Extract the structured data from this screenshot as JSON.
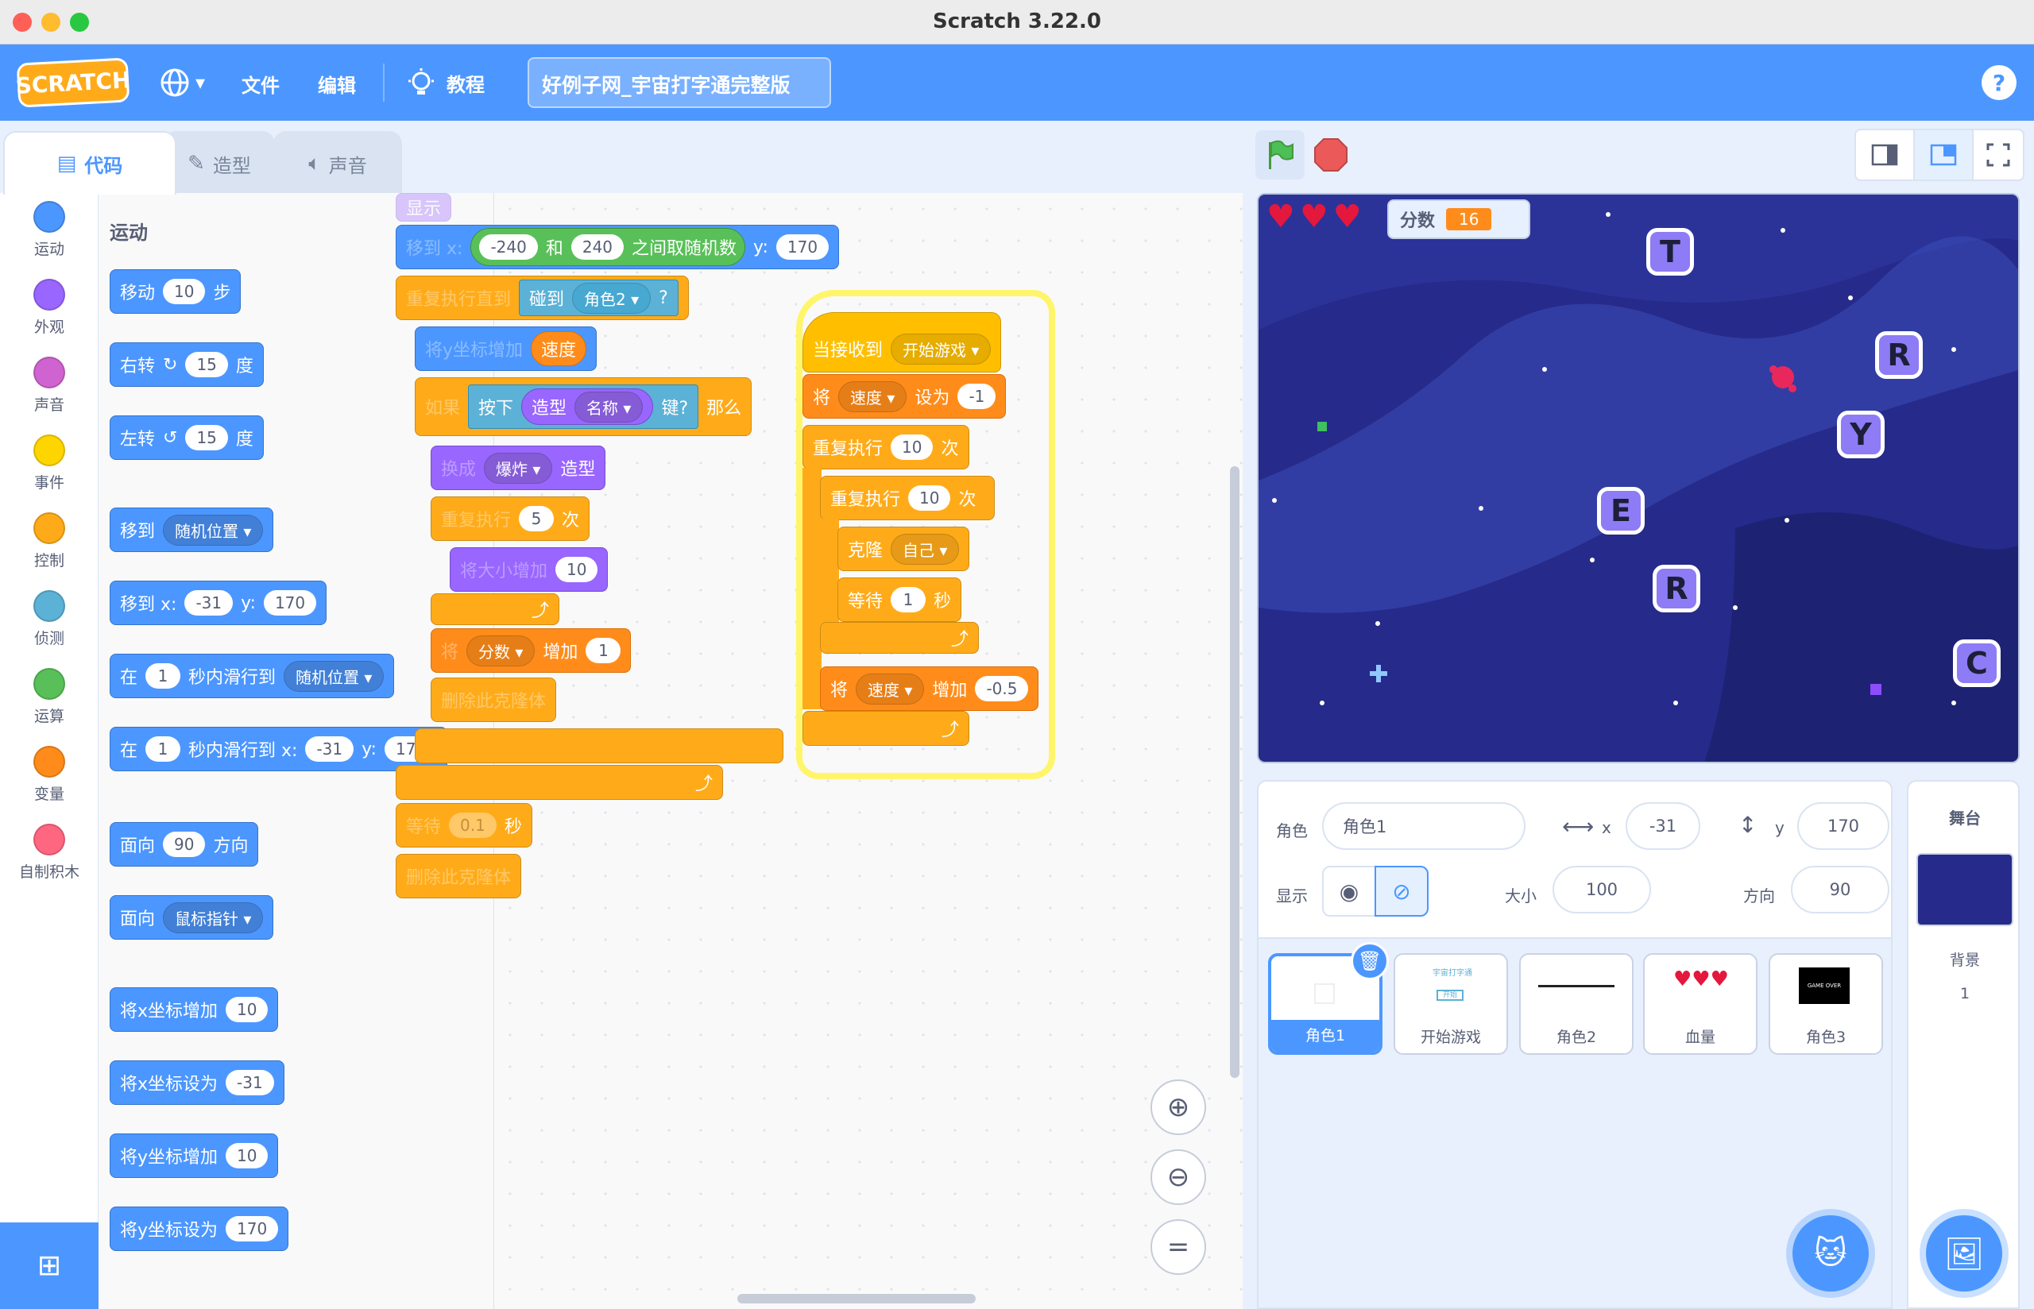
{
  "window": {
    "title": "Scratch 3.22.0"
  },
  "menu": {
    "logo": "SCRATCH",
    "file": "文件",
    "edit": "编辑",
    "tutorials": "教程",
    "project_title": "好例子网_宇宙打字通完整版",
    "help": "?"
  },
  "tabs": {
    "code": "代码",
    "costumes": "造型",
    "sounds": "声音"
  },
  "categories": [
    {
      "label": "运动",
      "color": "#4c97ff"
    },
    {
      "label": "外观",
      "color": "#9966ff"
    },
    {
      "label": "声音",
      "color": "#cf63cf"
    },
    {
      "label": "事件",
      "color": "#ffd500"
    },
    {
      "label": "控制",
      "color": "#ffab19"
    },
    {
      "label": "侦测",
      "color": "#5cb1d6"
    },
    {
      "label": "运算",
      "color": "#59c059"
    },
    {
      "label": "变量",
      "color": "#ff8c1a"
    },
    {
      "label": "自制积木",
      "color": "#ff6680"
    }
  ],
  "palette": {
    "heading": "运动",
    "move": {
      "a": "移动",
      "v": "10",
      "b": "步"
    },
    "turn_right": {
      "a": "右转",
      "v": "15",
      "b": "度"
    },
    "turn_left": {
      "a": "左转",
      "v": "15",
      "b": "度"
    },
    "goto": {
      "a": "移到",
      "v": "随机位置"
    },
    "goto_xy": {
      "a": "移到 x:",
      "x": "-31",
      "ylab": "y:",
      "y": "170"
    },
    "glide": {
      "a": "在",
      "v": "1",
      "b": "秒内滑行到",
      "c": "随机位置"
    },
    "glide_xy": {
      "a": "在",
      "v": "1",
      "b": "秒内滑行到 x:",
      "x": "-31",
      "ylab": "y:",
      "y": "170"
    },
    "point_dir": {
      "a": "面向",
      "v": "90",
      "b": "方向"
    },
    "point_towards": {
      "a": "面向",
      "v": "鼠标指针"
    },
    "change_x": {
      "a": "将x坐标增加",
      "v": "10"
    },
    "set_x": {
      "a": "将x坐标设为",
      "v": "-31"
    },
    "change_y": {
      "a": "将y坐标增加",
      "v": "10"
    },
    "set_y": {
      "a": "将y坐标设为",
      "v": "170"
    }
  },
  "script1": {
    "show": "显示",
    "goto_x": "移到 x:",
    "rand_from": "-240",
    "and": "和",
    "rand_to": "240",
    "rand_tail": "之间取随机数",
    "ylab": "y:",
    "y": "170",
    "repeat_until": "重复执行直到",
    "touching": "碰到",
    "touching_target": "角色2",
    "q": "?",
    "change_y": "将y坐标增加",
    "speed": "速度",
    "if": "如果",
    "key_press": "按下",
    "costume": "造型",
    "name": "名称",
    "key_q": "键?",
    "then": "那么",
    "switch": "换成",
    "explode": "爆炸",
    "costume2": "造型",
    "repeat": "重复执行",
    "repeat_n": "5",
    "times": "次",
    "size_change": "将大小增加",
    "size_v": "10",
    "set_var": "将",
    "score": "分数",
    "inc": "增加",
    "inc_v": "1",
    "delete_clone": "删除此克隆体",
    "wait": "等待",
    "wait_v": "0.1",
    "sec": "秒",
    "delete_clone2": "删除此克隆体"
  },
  "script2": {
    "hat": "当接收到",
    "hat_msg": "开始游戏",
    "set": "将",
    "speed": "速度",
    "set_to": "设为",
    "set_v": "-1",
    "repeat": "重复执行",
    "repeat_n": "10",
    "times": "次",
    "repeat2": "重复执行",
    "repeat2_n": "10",
    "times2": "次",
    "clone": "克隆",
    "clone_target": "自己",
    "wait": "等待",
    "wait_v": "1",
    "sec": "秒",
    "change": "将",
    "speed2": "速度",
    "inc": "增加",
    "inc_v": "-0.5"
  },
  "stage": {
    "score_label": "分数",
    "score_value": "16",
    "hearts": 3,
    "letters": [
      "T",
      "R",
      "Y",
      "E",
      "R",
      "C"
    ]
  },
  "sprite_info": {
    "sprite_label": "角色",
    "sprite_name": "角色1",
    "x_label": "x",
    "x": "-31",
    "y_label": "y",
    "y": "170",
    "show_label": "显示",
    "size_label": "大小",
    "size": "100",
    "direction_label": "方向",
    "direction": "90"
  },
  "sprites": [
    {
      "name": "角色1",
      "selected": true
    },
    {
      "name": "开始游戏",
      "selected": false
    },
    {
      "name": "角色2",
      "selected": false
    },
    {
      "name": "血量",
      "selected": false
    },
    {
      "name": "角色3",
      "selected": false
    }
  ],
  "sprite_thumbs": {
    "start_caption": "宇宙打字通",
    "start_btn": "开始",
    "gameover": "GAME OVER"
  },
  "stage_panel": {
    "title": "舞台",
    "backdrop_label": "背景",
    "backdrop_count": "1"
  },
  "colors": {
    "accent": "#4c97ff",
    "motion": "#4c97ff",
    "control": "#ffab19",
    "event": "#ffbf00"
  }
}
